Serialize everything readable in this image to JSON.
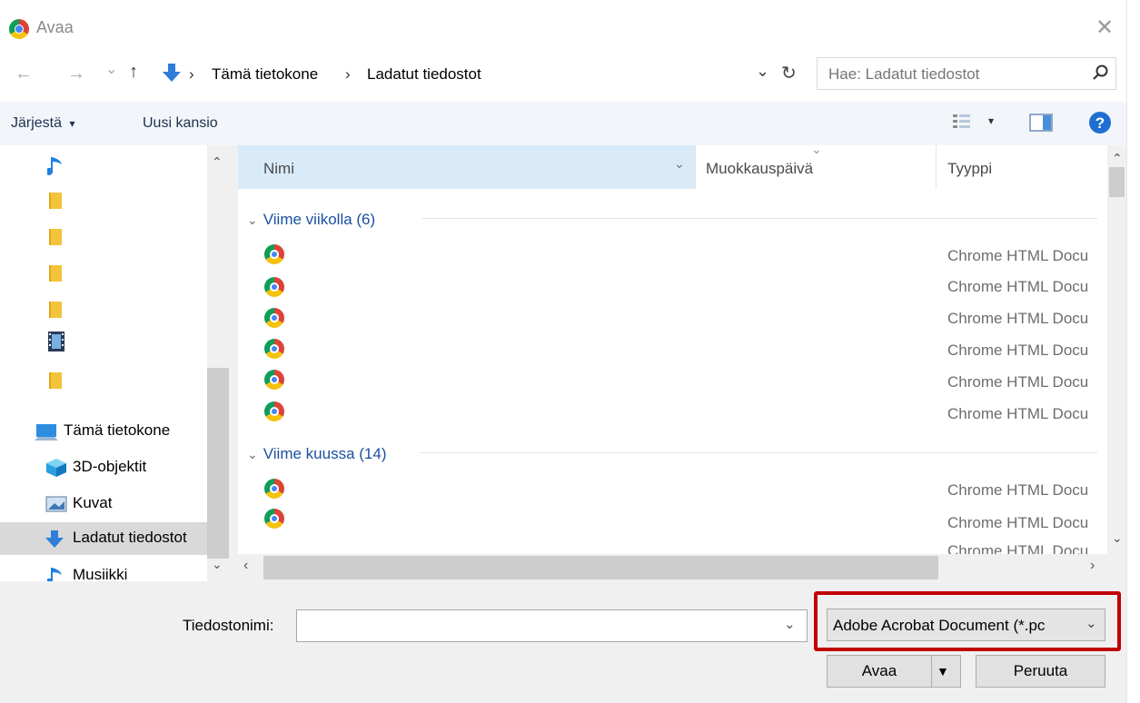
{
  "window": {
    "title": "Avaa",
    "close_glyph": "✕"
  },
  "nav": {
    "back_glyph": "←",
    "forward_glyph": "→",
    "recent_glyph": "⌄",
    "up_glyph": "↑",
    "breadcrumb": [
      "Tämä tietokone",
      "Ladatut tiedostot"
    ],
    "separator": "›",
    "dropdown_glyph": "⌄",
    "refresh_glyph": "↻"
  },
  "search": {
    "placeholder": "Hae: Ladatut tiedostot"
  },
  "toolbar": {
    "organize": "Järjestä",
    "organize_arrow": "▾",
    "new_folder": "Uusi kansio"
  },
  "sidebar": {
    "items": [
      {
        "label": "Tämä tietokone",
        "icon": "computer-icon"
      },
      {
        "label": "3D-objektit",
        "icon": "cube-icon"
      },
      {
        "label": "Kuvat",
        "icon": "pictures-icon"
      },
      {
        "label": "Ladatut tiedostot",
        "icon": "download-icon",
        "selected": true
      },
      {
        "label": "Musiikki",
        "icon": "music-icon"
      }
    ]
  },
  "columns": {
    "name": "Nimi",
    "modified": "Muokkauspäivä",
    "type": "Tyyppi"
  },
  "groups": [
    {
      "label": "Viime viikolla (6)",
      "rows": [
        "Chrome HTML Docu",
        "Chrome HTML Docu",
        "Chrome HTML Docu",
        "Chrome HTML Docu",
        "Chrome HTML Docu",
        "Chrome HTML Docu"
      ]
    },
    {
      "label": "Viime kuussa (14)",
      "rows": [
        "Chrome HTML Docu",
        "Chrome HTML Docu",
        "Chrome HTML Docu"
      ]
    }
  ],
  "footer": {
    "filename_label": "Tiedostonimi:",
    "filename_value": "",
    "filetype": "Adobe Acrobat Document (*.pc",
    "open_button": "Avaa",
    "cancel_button": "Peruuta"
  },
  "colors": {
    "highlight": "#c00000",
    "selected_header": "#d9eaf9",
    "group_text": "#1a4fa0"
  }
}
